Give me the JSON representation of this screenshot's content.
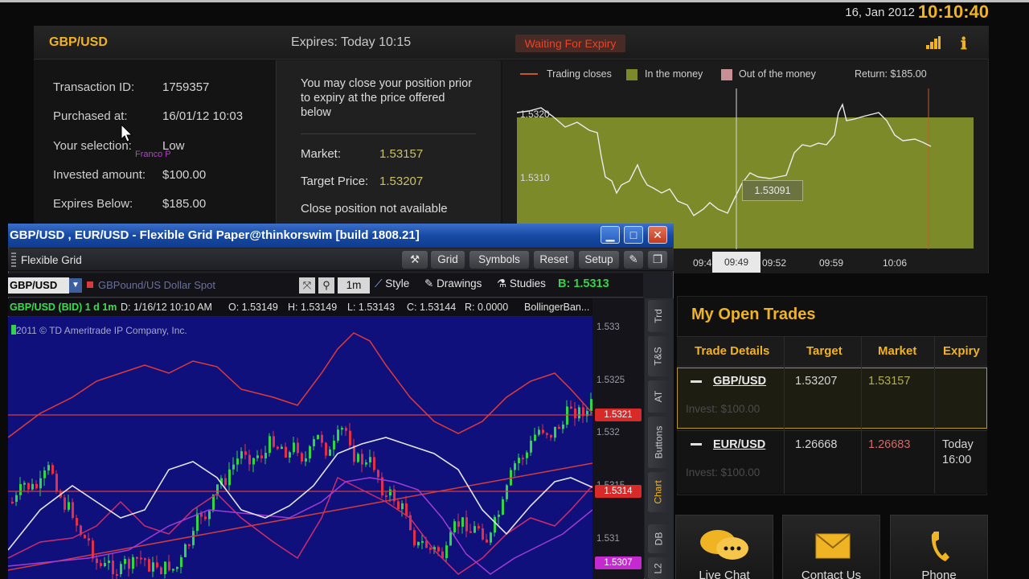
{
  "header": {
    "date": "16, Jan 2012",
    "time": "10:10:40"
  },
  "position": {
    "pair": "GBP/USD",
    "expires": "Expires:  Today 10:15",
    "status": "Waiting For Expiry",
    "details": [
      {
        "label": "Transaction ID:",
        "value": "1759357"
      },
      {
        "label": "Purchased at:",
        "value": "16/01/12 10:03"
      },
      {
        "label": "Your selection:",
        "value": "Low"
      },
      {
        "label": "Invested amount:",
        "value": "$100.00"
      },
      {
        "label": "Expires Below:",
        "value": "$185.00"
      }
    ],
    "annotation": "Franco P"
  },
  "close_position": {
    "text": "You may close your position prior to expiry at the price offered below",
    "market_label": "Market:",
    "market_value": "1.53157",
    "target_label": "Target Price:",
    "target_value": "1.53207",
    "status": "Close position not available"
  },
  "mini_chart": {
    "legend": [
      {
        "label": "Trading closes",
        "color": "#c4572e"
      },
      {
        "label": "In the money",
        "color": "#7c8a2a"
      },
      {
        "label": "Out of the money",
        "color": "#c88f95"
      }
    ],
    "return_label": "Return: $185.00",
    "y_labels": [
      "1.5320",
      "1.5310"
    ],
    "x_labels": [
      "09:4",
      "09:49",
      "09:52",
      "09:59",
      "10:06"
    ],
    "tooltip": "1.53091"
  },
  "open_trades": {
    "title": "My Open Trades",
    "columns": [
      "Trade Details",
      "Target",
      "Market",
      "Expiry"
    ],
    "rows": [
      {
        "pair": "GBP/USD",
        "invest": "Invest: $100.00",
        "target": "1.53207",
        "market": "1.53157",
        "expiry": ""
      },
      {
        "pair": "EUR/USD",
        "invest": "Invest: $100.00",
        "target": "1.26668",
        "market": "1.26683",
        "expiry_line1": "Today",
        "expiry_line2": "16:00"
      }
    ]
  },
  "contact": {
    "live_chat": "Live Chat",
    "contact_us": "Contact Us",
    "phone": "Phone"
  },
  "tos_window": {
    "title": "GBP/USD , EUR/USD - Flexible Grid Paper@thinkorswim [build 1808.21]",
    "layout_label": "Flexible Grid",
    "toolbar": [
      "Grid",
      "Symbols",
      "Reset",
      "Setup"
    ],
    "symbol": "GBP/USD",
    "symbol_desc": "GBPound/US Dollar Spot",
    "timeframe": "1m",
    "style_label": "Style",
    "drawings_label": "Drawings",
    "studies_label": "Studies",
    "bid": "B: 1.5313",
    "info": {
      "series": "GBP/USD (BID) 1 d 1m",
      "date": "D: 1/16/12 10:10 AM",
      "open": "O: 1.53149",
      "high": "H: 1.53149",
      "low": "L: 1.53143",
      "close": "C: 1.53144",
      "range": "R: 0.0000",
      "study": "BollingerBan..."
    },
    "copyright": "2011 © TD Ameritrade IP Company, Inc.",
    "price_axis": [
      "1.533",
      "1.5325",
      "1.532",
      "1.5315",
      "1.531"
    ],
    "price_tags": [
      "1.5321",
      "1.5314",
      "1.5307"
    ],
    "side_tabs": [
      "Trd",
      "T&S",
      "AT",
      "Buttons",
      "Chart",
      "DB",
      "L2"
    ]
  }
}
